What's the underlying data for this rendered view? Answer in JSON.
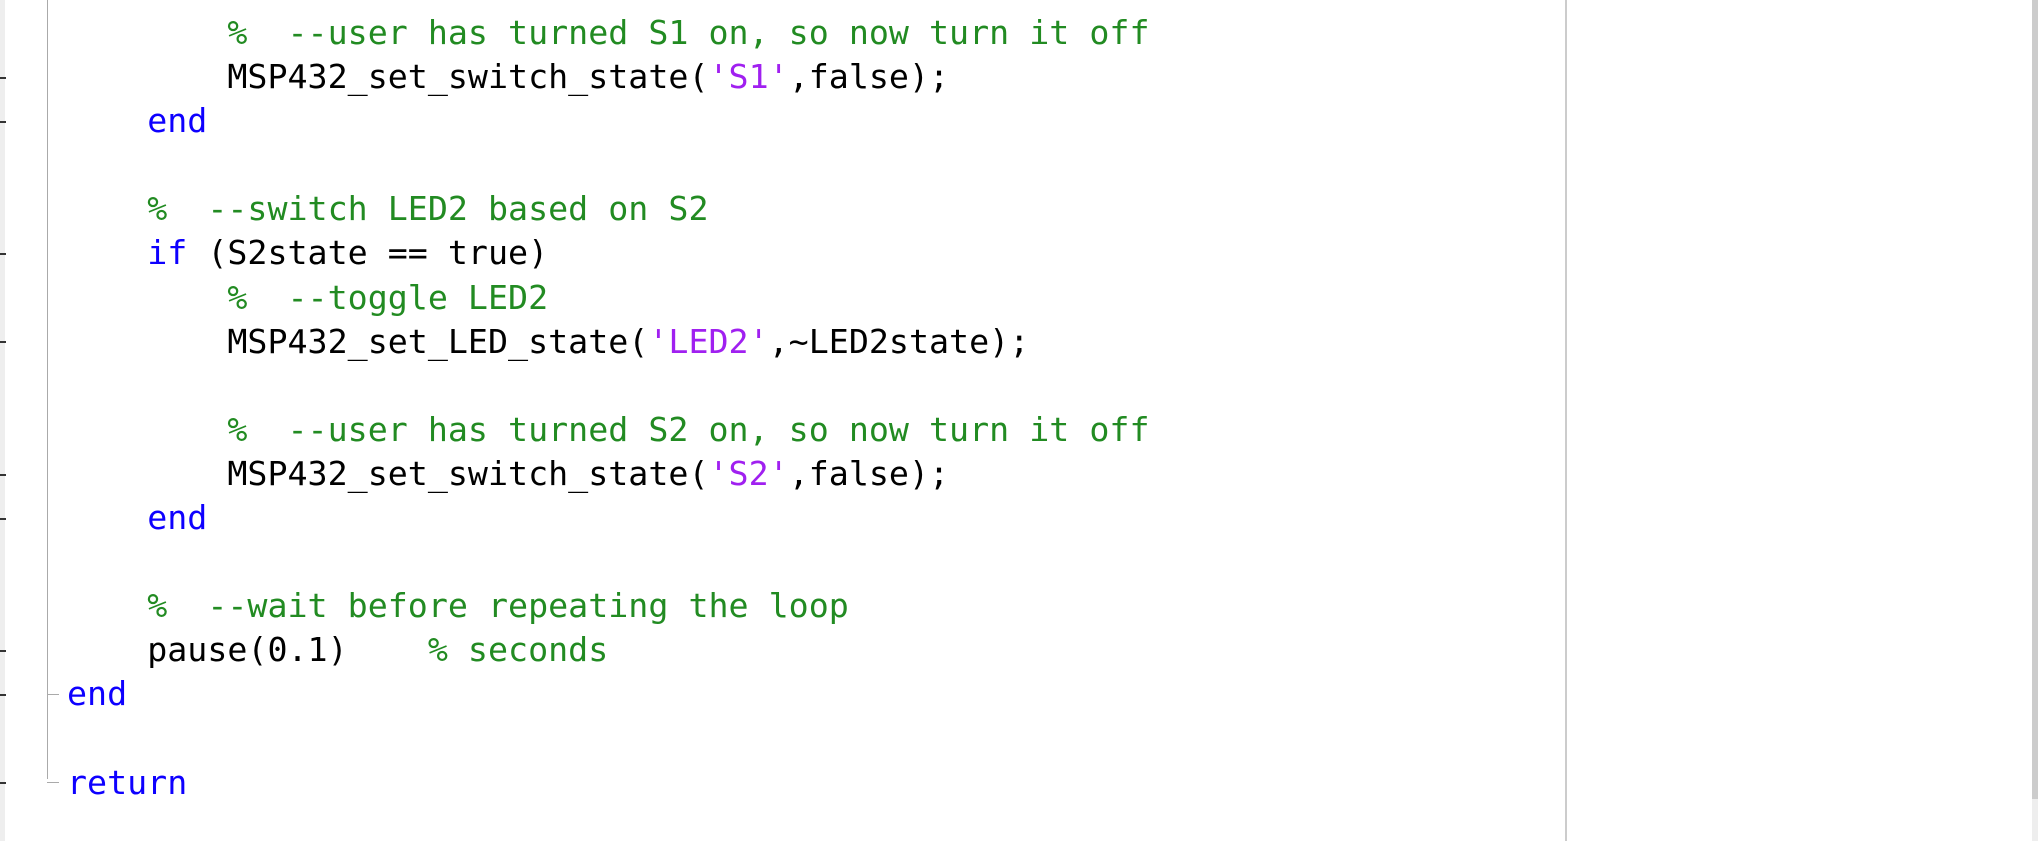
{
  "editor": {
    "colors": {
      "keyword": "#0e00ff",
      "comment": "#228b22",
      "string": "#a020f0",
      "text": "#000000"
    },
    "scrollbar": {
      "thumb_fraction": 0.95
    },
    "lines": [
      {
        "indent": 2,
        "tokens": [
          {
            "t": "cm",
            "v": "%  --user has turned S1 on, so now turn it off"
          }
        ],
        "executable": false
      },
      {
        "indent": 2,
        "tokens": [
          {
            "t": "tx",
            "v": "MSP432_set_switch_state("
          },
          {
            "t": "str",
            "v": "'S1'"
          },
          {
            "t": "tx",
            "v": ",false);"
          }
        ],
        "executable": true
      },
      {
        "indent": 1,
        "tokens": [
          {
            "t": "kw",
            "v": "end"
          }
        ],
        "executable": true
      },
      {
        "indent": 0,
        "tokens": [],
        "executable": false
      },
      {
        "indent": 1,
        "tokens": [
          {
            "t": "cm",
            "v": "%  --switch LED2 based on S2"
          }
        ],
        "executable": false
      },
      {
        "indent": 1,
        "tokens": [
          {
            "t": "kw",
            "v": "if"
          },
          {
            "t": "tx",
            "v": " (S2state == true)"
          }
        ],
        "executable": true
      },
      {
        "indent": 2,
        "tokens": [
          {
            "t": "cm",
            "v": "%  --toggle LED2"
          }
        ],
        "executable": false
      },
      {
        "indent": 2,
        "tokens": [
          {
            "t": "tx",
            "v": "MSP432_set_LED_state("
          },
          {
            "t": "str",
            "v": "'LED2'"
          },
          {
            "t": "tx",
            "v": ",~LED2state);"
          }
        ],
        "executable": true
      },
      {
        "indent": 0,
        "tokens": [],
        "executable": false
      },
      {
        "indent": 2,
        "tokens": [
          {
            "t": "cm",
            "v": "%  --user has turned S2 on, so now turn it off"
          }
        ],
        "executable": false
      },
      {
        "indent": 2,
        "tokens": [
          {
            "t": "tx",
            "v": "MSP432_set_switch_state("
          },
          {
            "t": "str",
            "v": "'S2'"
          },
          {
            "t": "tx",
            "v": ",false);"
          }
        ],
        "executable": true
      },
      {
        "indent": 1,
        "tokens": [
          {
            "t": "kw",
            "v": "end"
          }
        ],
        "executable": true
      },
      {
        "indent": 0,
        "tokens": [],
        "executable": false
      },
      {
        "indent": 1,
        "tokens": [
          {
            "t": "cm",
            "v": "%  --wait before repeating the loop"
          }
        ],
        "executable": false
      },
      {
        "indent": 1,
        "tokens": [
          {
            "t": "tx",
            "v": "pause(0.1)    "
          },
          {
            "t": "cm",
            "v": "% seconds"
          }
        ],
        "executable": true
      },
      {
        "indent": 0,
        "tokens": [
          {
            "t": "kw",
            "v": "end"
          }
        ],
        "executable": true,
        "fold_end": true
      },
      {
        "indent": 0,
        "tokens": [],
        "executable": false
      },
      {
        "indent": 0,
        "tokens": [
          {
            "t": "kw",
            "v": "return"
          }
        ],
        "executable": true,
        "fold_end": true
      }
    ]
  }
}
